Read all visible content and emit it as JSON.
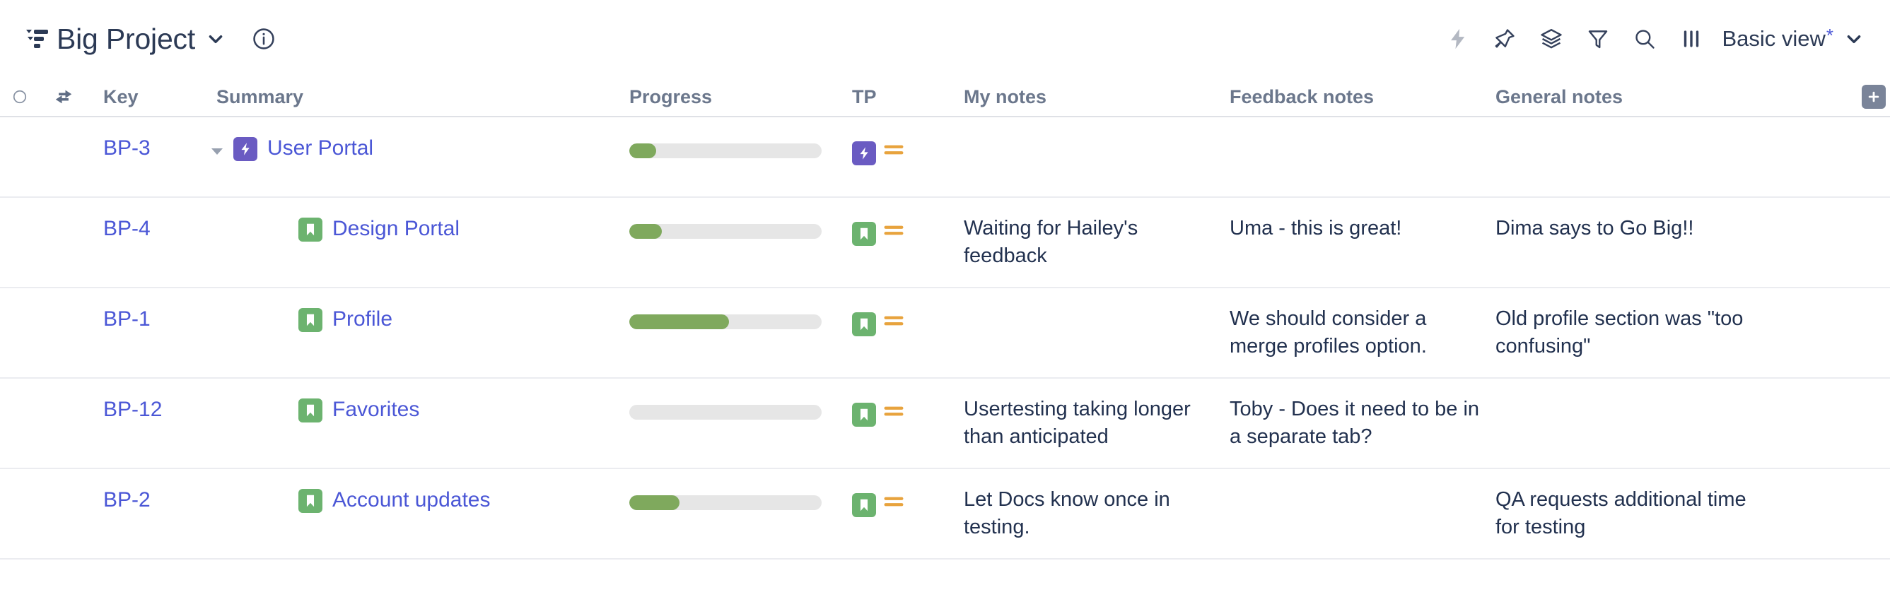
{
  "header": {
    "project_title": "Big Project",
    "board_icon": "board-hierarchy-icon",
    "title_dropdown_icon": "chevron-down-icon",
    "info_icon": "info-circle-icon",
    "toolbar": [
      {
        "name": "automation-icon",
        "glyph": "lightning-bolt",
        "dim": true
      },
      {
        "name": "pin-icon",
        "glyph": "pin",
        "dim": false
      },
      {
        "name": "layers-icon",
        "glyph": "layers",
        "dim": false
      },
      {
        "name": "filter-icon",
        "glyph": "funnel",
        "dim": false
      },
      {
        "name": "search-icon",
        "glyph": "magnifier",
        "dim": false
      },
      {
        "name": "columns-icon",
        "glyph": "columns",
        "dim": false
      }
    ],
    "view_label": "Basic view",
    "view_unsaved_marker": "*",
    "view_chevron_icon": "chevron-down-icon"
  },
  "table": {
    "columns": [
      {
        "key": "check",
        "label": "",
        "icon": "circle-select-icon"
      },
      {
        "key": "swap",
        "label": "",
        "icon": "swap-arrows-icon"
      },
      {
        "key": "key",
        "label": "Key"
      },
      {
        "key": "summary",
        "label": "Summary"
      },
      {
        "key": "progress",
        "label": "Progress"
      },
      {
        "key": "tp",
        "label": "TP"
      },
      {
        "key": "mynotes",
        "label": "My notes"
      },
      {
        "key": "feedback",
        "label": "Feedback notes"
      },
      {
        "key": "general",
        "label": "General notes"
      }
    ],
    "add_column_label": "+",
    "rows": [
      {
        "key": "BP-3",
        "summary": "User Portal",
        "issue_type": "epic",
        "indent": 0,
        "expanded": true,
        "has_twisty": true,
        "progress_percent": 14,
        "priority": "medium",
        "my_notes": "",
        "feedback_notes": "",
        "general_notes": ""
      },
      {
        "key": "BP-4",
        "summary": "Design Portal",
        "issue_type": "story",
        "indent": 1,
        "expanded": false,
        "has_twisty": false,
        "progress_percent": 17,
        "priority": "medium",
        "my_notes": "Waiting for Hailey's feedback",
        "feedback_notes": "Uma - this is great!",
        "general_notes": "Dima says to Go Big!!"
      },
      {
        "key": "BP-1",
        "summary": "Profile",
        "issue_type": "story",
        "indent": 1,
        "expanded": false,
        "has_twisty": false,
        "progress_percent": 52,
        "priority": "medium",
        "my_notes": "",
        "feedback_notes": "We should consider a merge profiles option.",
        "general_notes": "Old profile section was \"too confusing\""
      },
      {
        "key": "BP-12",
        "summary": "Favorites",
        "issue_type": "story",
        "indent": 1,
        "expanded": false,
        "has_twisty": false,
        "progress_percent": 0,
        "priority": "medium",
        "my_notes": "Usertesting taking longer than anticipated",
        "feedback_notes": "Toby - Does it need to be in a separate tab?",
        "general_notes": ""
      },
      {
        "key": "BP-2",
        "summary": "Account updates",
        "issue_type": "story",
        "indent": 1,
        "expanded": false,
        "has_twisty": false,
        "progress_percent": 26,
        "priority": "medium",
        "my_notes": "Let Docs know once in testing.",
        "feedback_notes": "",
        "general_notes": "QA requests additional time for testing"
      }
    ]
  },
  "colors": {
    "link": "#4b57d6",
    "epic": "#6a5bc2",
    "story": "#6cb36f",
    "progress_fill": "#7fa95d",
    "progress_track": "#e6e6e6",
    "priority_medium": "#e8a33d",
    "header_text": "#6b778c"
  }
}
